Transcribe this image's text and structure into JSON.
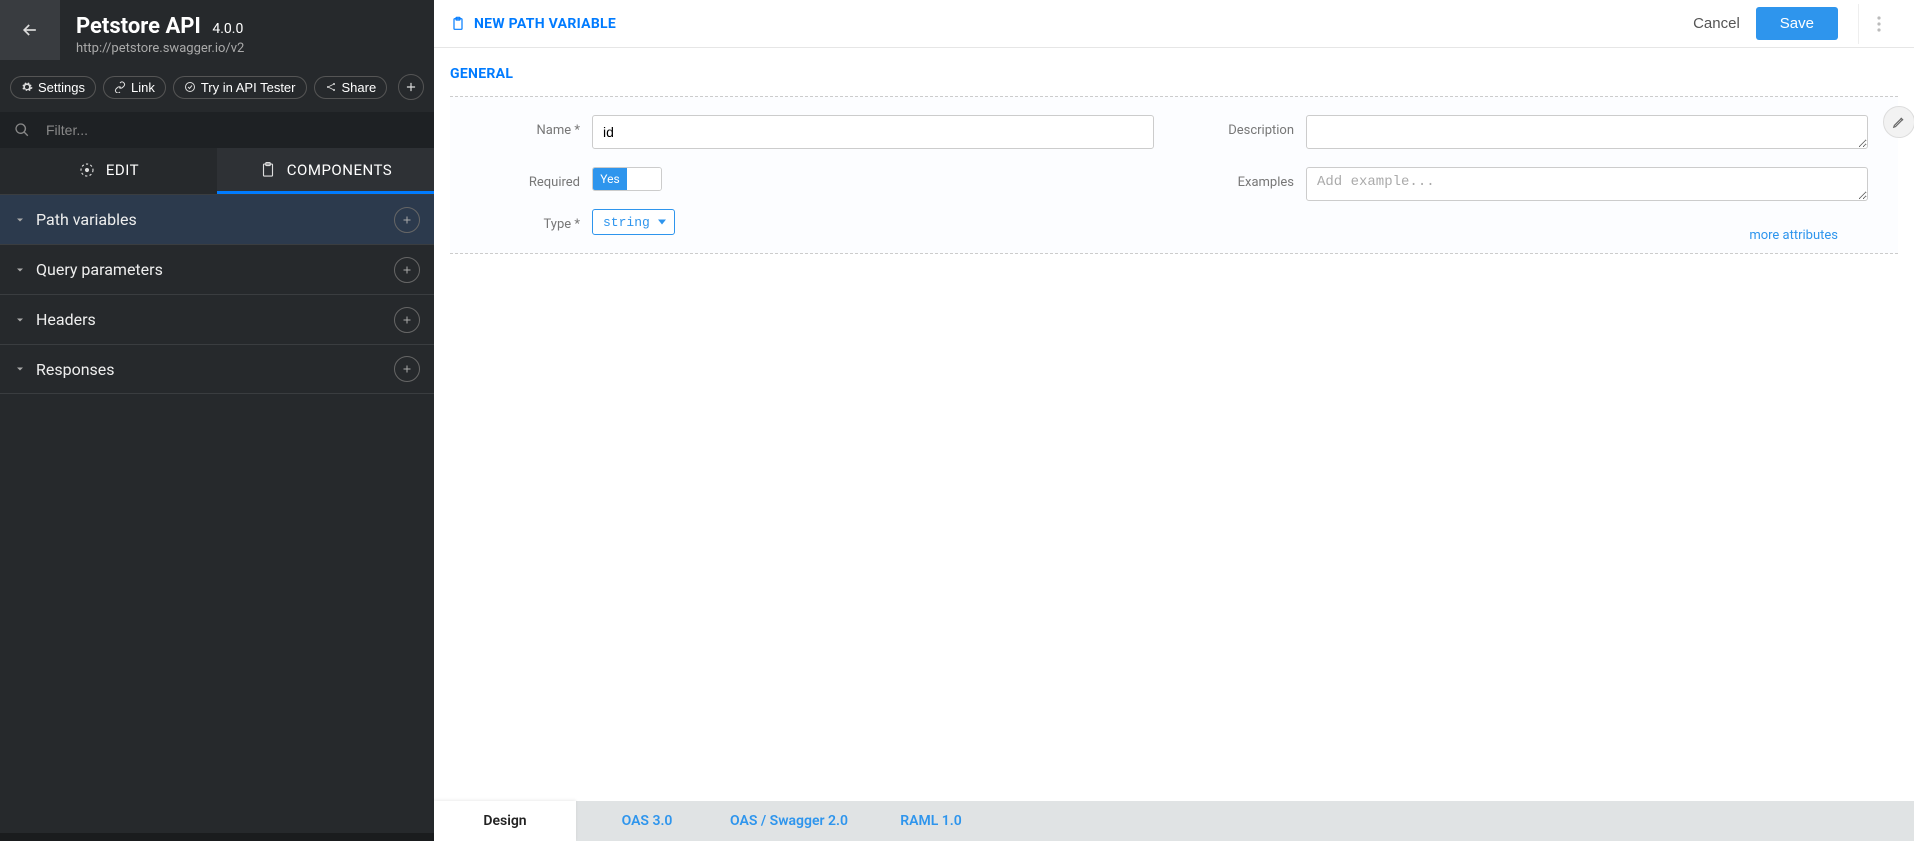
{
  "sidebar": {
    "title": "Petstore API",
    "version": "4.0.0",
    "url": "http://petstore.swagger.io/v2",
    "buttons": {
      "settings": "Settings",
      "link": "Link",
      "try": "Try in API Tester",
      "share": "Share"
    },
    "filter_placeholder": "Filter...",
    "tabs": {
      "edit": "EDIT",
      "components": "COMPONENTS"
    },
    "sections": [
      {
        "label": "Path variables"
      },
      {
        "label": "Query parameters"
      },
      {
        "label": "Headers"
      },
      {
        "label": "Responses"
      }
    ]
  },
  "main": {
    "header": {
      "title": "NEW PATH VARIABLE",
      "cancel": "Cancel",
      "save": "Save"
    },
    "general": {
      "section_title": "GENERAL",
      "name_label": "Name",
      "name_value": "id",
      "required_label": "Required",
      "required_yes": "Yes",
      "type_label": "Type",
      "type_value": "string",
      "description_label": "Description",
      "examples_label": "Examples",
      "examples_placeholder": "Add example...",
      "more_attributes": "more attributes"
    },
    "bottom_tabs": {
      "design": "Design",
      "oas3": "OAS 3.0",
      "oas2": "OAS / Swagger 2.0",
      "raml": "RAML 1.0"
    }
  }
}
